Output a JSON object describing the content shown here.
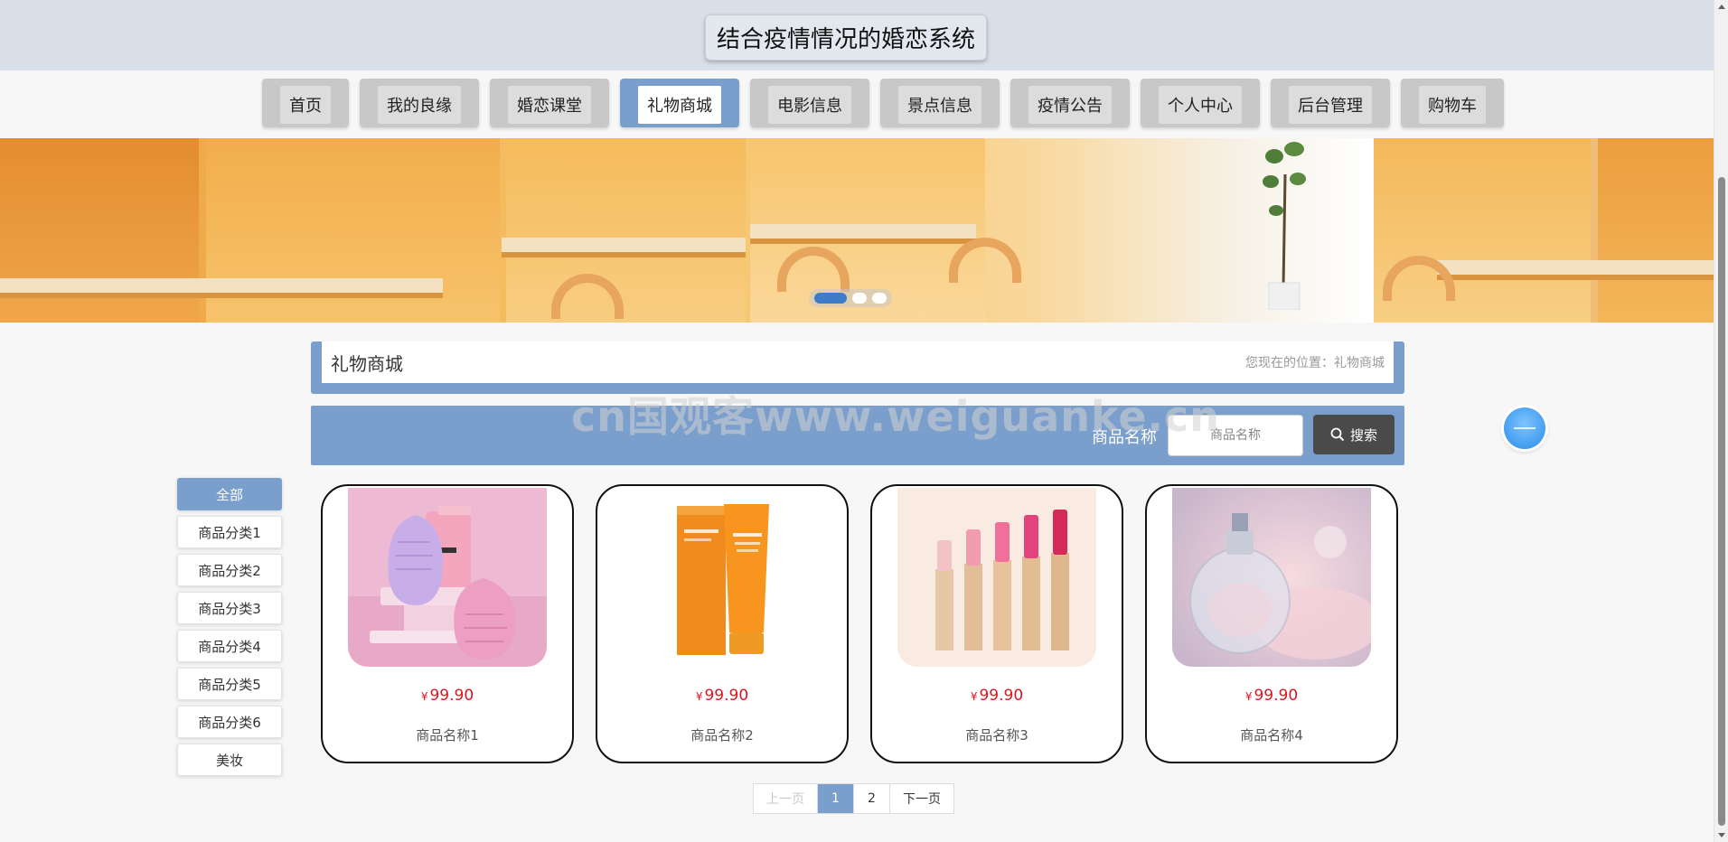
{
  "header": {
    "site_title": "结合疫情情况的婚恋系统"
  },
  "nav": {
    "items": [
      {
        "label": "首页"
      },
      {
        "label": "我的良缘"
      },
      {
        "label": "婚恋课堂"
      },
      {
        "label": "礼物商城",
        "active": true
      },
      {
        "label": "电影信息"
      },
      {
        "label": "景点信息"
      },
      {
        "label": "疫情公告"
      },
      {
        "label": "个人中心"
      },
      {
        "label": "后台管理"
      },
      {
        "label": "购物车"
      }
    ]
  },
  "banner": {
    "slide_count": 3,
    "active_slide": 1
  },
  "breadcrumb": {
    "title": "礼物商城",
    "position": "您现在的位置：礼物商城"
  },
  "search": {
    "label": "商品名称",
    "placeholder": "商品名称",
    "button_label": "搜索"
  },
  "watermark": "cn国观客www.weiguanke.cn",
  "categories": [
    {
      "label": "全部",
      "active": true
    },
    {
      "label": "商品分类1"
    },
    {
      "label": "商品分类2"
    },
    {
      "label": "商品分类3"
    },
    {
      "label": "商品分类4"
    },
    {
      "label": "商品分类5"
    },
    {
      "label": "商品分类6"
    },
    {
      "label": "美妆"
    }
  ],
  "products": [
    {
      "name": "商品名称1",
      "currency": "¥",
      "price": "99.90",
      "image": "beauty-device-image"
    },
    {
      "name": "商品名称2",
      "currency": "¥",
      "price": "99.90",
      "image": "sunscreen-image"
    },
    {
      "name": "商品名称3",
      "currency": "¥",
      "price": "99.90",
      "image": "lipstick-image"
    },
    {
      "name": "商品名称4",
      "currency": "¥",
      "price": "99.90",
      "image": "perfume-image"
    }
  ],
  "pagination": {
    "prev_label": "上一页",
    "pages": [
      "1",
      "2"
    ],
    "current": "1",
    "next_label": "下一页"
  },
  "colors": {
    "accent": "#7b9fcc",
    "header_bg": "#d9e0e9",
    "price": "#e0161e",
    "search_button": "#4a4a4a"
  }
}
